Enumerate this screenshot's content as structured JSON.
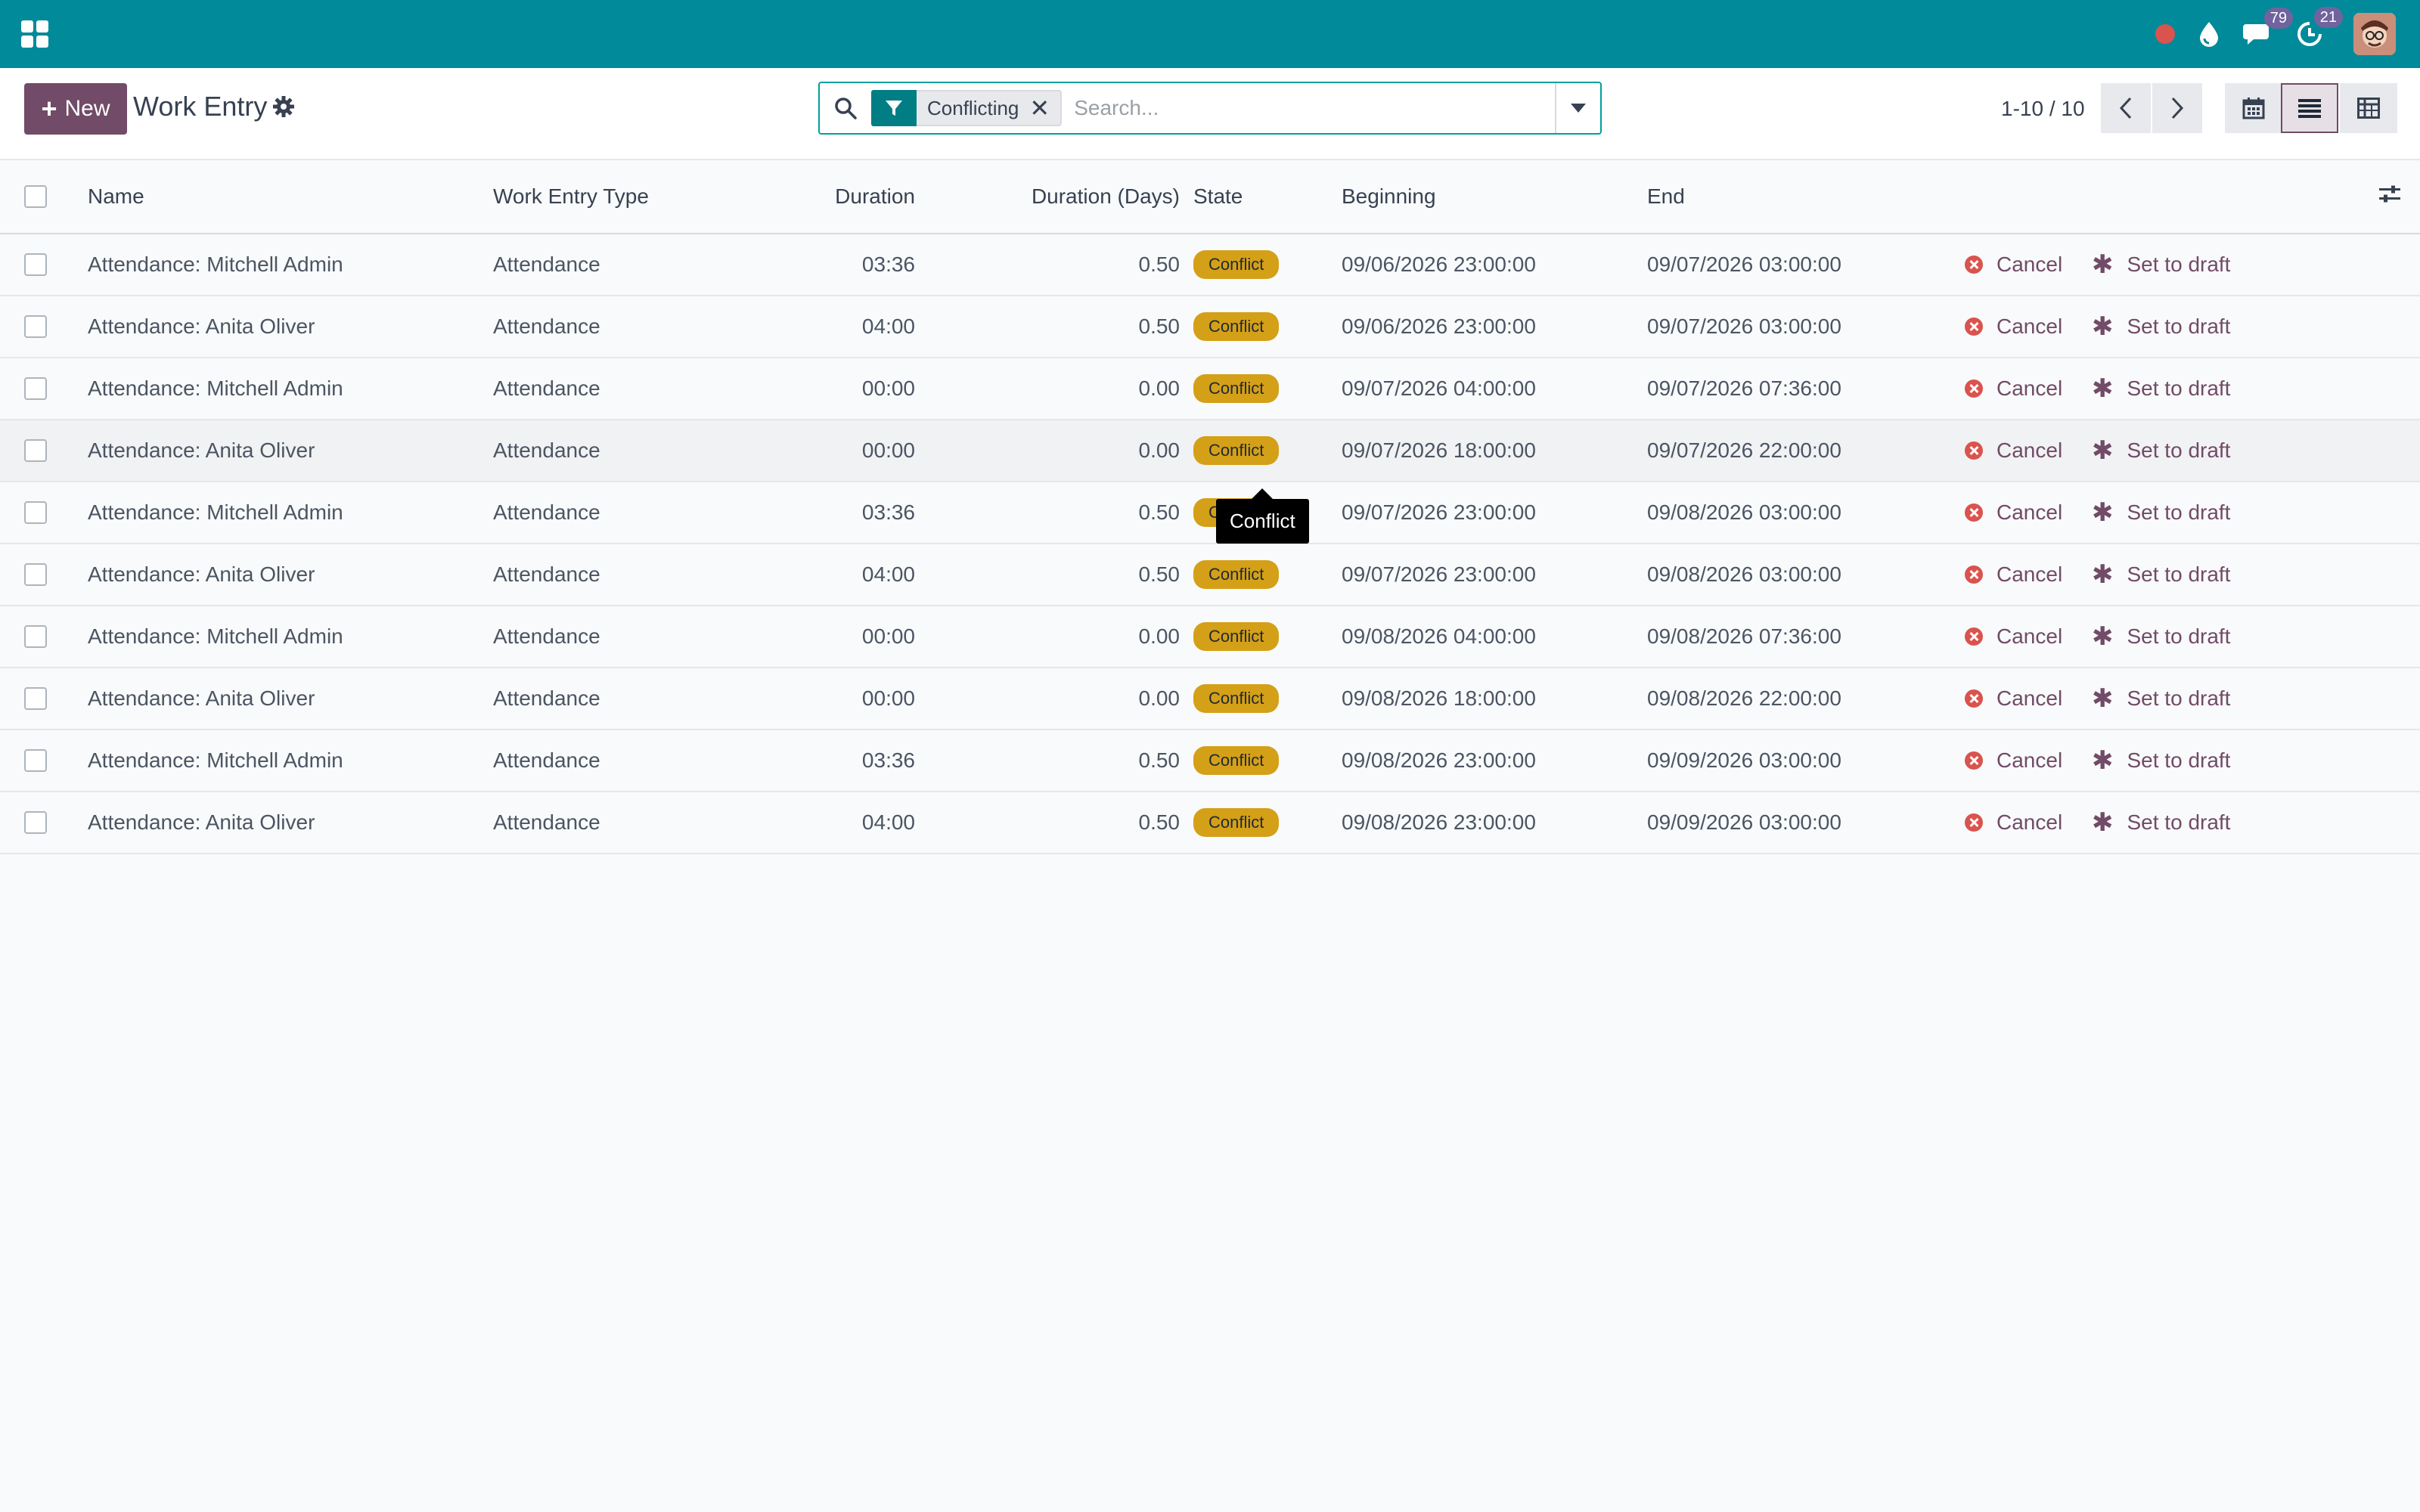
{
  "topbar": {
    "messages_count": "79",
    "activities_count": "21"
  },
  "control_panel": {
    "new_label": "New",
    "title": "Work Entry",
    "search": {
      "facet_label": "Conflicting",
      "placeholder": "Search..."
    },
    "pager": "1-10 / 10"
  },
  "table": {
    "headers": {
      "name": "Name",
      "type": "Work Entry Type",
      "duration": "Duration",
      "days": "Duration (Days)",
      "state": "State",
      "beginning": "Beginning",
      "end": "End"
    },
    "rows": [
      {
        "name": "Attendance: Mitchell Admin",
        "type": "Attendance",
        "duration": "03:36",
        "days": "0.50",
        "state": "Conflict",
        "beginning": "09/06/2026 23:00:00",
        "end": "09/07/2026 03:00:00",
        "cancel": "Cancel",
        "draft": "Set to draft"
      },
      {
        "name": "Attendance: Anita Oliver",
        "type": "Attendance",
        "duration": "04:00",
        "days": "0.50",
        "state": "Conflict",
        "beginning": "09/06/2026 23:00:00",
        "end": "09/07/2026 03:00:00",
        "cancel": "Cancel",
        "draft": "Set to draft"
      },
      {
        "name": "Attendance: Mitchell Admin",
        "type": "Attendance",
        "duration": "00:00",
        "days": "0.00",
        "state": "Conflict",
        "beginning": "09/07/2026 04:00:00",
        "end": "09/07/2026 07:36:00",
        "cancel": "Cancel",
        "draft": "Set to draft"
      },
      {
        "name": "Attendance: Anita Oliver",
        "type": "Attendance",
        "duration": "00:00",
        "days": "0.00",
        "state": "Conflict",
        "beginning": "09/07/2026 18:00:00",
        "end": "09/07/2026 22:00:00",
        "cancel": "Cancel",
        "draft": "Set to draft"
      },
      {
        "name": "Attendance: Mitchell Admin",
        "type": "Attendance",
        "duration": "03:36",
        "days": "0.50",
        "state": "Conflict",
        "beginning": "09/07/2026 23:00:00",
        "end": "09/08/2026 03:00:00",
        "cancel": "Cancel",
        "draft": "Set to draft"
      },
      {
        "name": "Attendance: Anita Oliver",
        "type": "Attendance",
        "duration": "04:00",
        "days": "0.50",
        "state": "Conflict",
        "beginning": "09/07/2026 23:00:00",
        "end": "09/08/2026 03:00:00",
        "cancel": "Cancel",
        "draft": "Set to draft"
      },
      {
        "name": "Attendance: Mitchell Admin",
        "type": "Attendance",
        "duration": "00:00",
        "days": "0.00",
        "state": "Conflict",
        "beginning": "09/08/2026 04:00:00",
        "end": "09/08/2026 07:36:00",
        "cancel": "Cancel",
        "draft": "Set to draft"
      },
      {
        "name": "Attendance: Anita Oliver",
        "type": "Attendance",
        "duration": "00:00",
        "days": "0.00",
        "state": "Conflict",
        "beginning": "09/08/2026 18:00:00",
        "end": "09/08/2026 22:00:00",
        "cancel": "Cancel",
        "draft": "Set to draft"
      },
      {
        "name": "Attendance: Mitchell Admin",
        "type": "Attendance",
        "duration": "03:36",
        "days": "0.50",
        "state": "Conflict",
        "beginning": "09/08/2026 23:00:00",
        "end": "09/09/2026 03:00:00",
        "cancel": "Cancel",
        "draft": "Set to draft"
      },
      {
        "name": "Attendance: Anita Oliver",
        "type": "Attendance",
        "duration": "04:00",
        "days": "0.50",
        "state": "Conflict",
        "beginning": "09/08/2026 23:00:00",
        "end": "09/09/2026 03:00:00",
        "cancel": "Cancel",
        "draft": "Set to draft"
      }
    ]
  },
  "tooltip": {
    "text": "Conflict"
  },
  "colors": {
    "topbar": "#008a9a",
    "primary": "#714b67",
    "conflict_badge": "#d4a017",
    "cancel_icon": "#d9534f"
  },
  "icons": {
    "apps": "apps-icon",
    "record": "record-icon",
    "drop": "drop-icon",
    "chat": "chat-icon",
    "activity": "activity-icon",
    "settings": "gear-icon",
    "search": "search-icon",
    "filter": "filter-icon",
    "calendar": "calendar-icon",
    "list": "list-icon",
    "pivot": "pivot-icon"
  }
}
